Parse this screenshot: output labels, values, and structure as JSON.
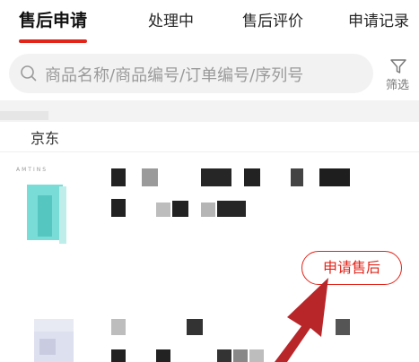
{
  "tabs": [
    {
      "label": "售后申请",
      "active": true
    },
    {
      "label": "处理中",
      "active": false
    },
    {
      "label": "售后评价",
      "active": false
    },
    {
      "label": "申请记录",
      "active": false
    }
  ],
  "search": {
    "placeholder": "商品名称/商品编号/订单编号/序列号"
  },
  "filter": {
    "label": "筛选",
    "icon": "filter-funnel-icon"
  },
  "shop": {
    "name": "京东"
  },
  "products": [
    {
      "thumb_text": "AMTINS",
      "action_label": "申请售后"
    },
    {
      "thumb_text": ""
    }
  ],
  "colors": {
    "accent": "#e1251b",
    "arrow": "#b8262a",
    "search_bg": "#f2f2f2"
  }
}
